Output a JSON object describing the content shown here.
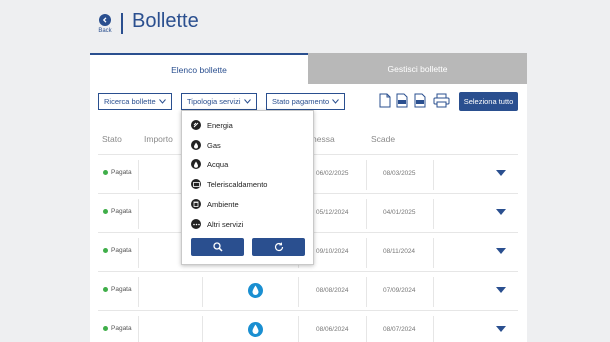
{
  "header": {
    "back_label": "Back",
    "title": "Bollette"
  },
  "tabs": [
    {
      "label": "Elenco bollette",
      "active": true
    },
    {
      "label": "Gestisci bollette",
      "active": false
    }
  ],
  "filters": {
    "search": "Ricerca bollette",
    "service_type": "Tipologia servizi",
    "payment_status": "Stato pagamento"
  },
  "toolbar": {
    "select_all": "Seleziona tutto"
  },
  "table": {
    "headers": {
      "stato": "Stato",
      "importo": "Importo",
      "emissione": "nessa",
      "scadenza": "Scade"
    },
    "rows": [
      {
        "status": "Pagata",
        "issued": "06/02/2025",
        "due": "08/03/2025",
        "icon": ""
      },
      {
        "status": "Pagata",
        "issued": "05/12/2024",
        "due": "04/01/2025",
        "icon": ""
      },
      {
        "status": "Pagata",
        "issued": "09/10/2024",
        "due": "08/11/2024",
        "icon": ""
      },
      {
        "status": "Pagata",
        "issued": "08/08/2024",
        "due": "07/09/2024",
        "icon": "water-drop-icon"
      },
      {
        "status": "Pagata",
        "issued": "08/06/2024",
        "due": "08/07/2024",
        "icon": "water-drop-icon"
      }
    ]
  },
  "dropdown": {
    "options": [
      {
        "label": "Energia",
        "icon": "energy-icon"
      },
      {
        "label": "Gas",
        "icon": "flame-icon"
      },
      {
        "label": "Acqua",
        "icon": "drop-icon"
      },
      {
        "label": "Teleriscaldamento",
        "icon": "district-heating-icon"
      },
      {
        "label": "Ambiente",
        "icon": "waste-bin-icon"
      },
      {
        "label": "Altri servizi",
        "icon": "more-icon"
      }
    ],
    "search_button": "search-icon",
    "reset_button": "refresh-icon"
  },
  "colors": {
    "primary": "#2a4f8f",
    "accent": "#1a8fd1",
    "paid": "#3fae49",
    "tab_inactive": "#b8b8b8"
  }
}
